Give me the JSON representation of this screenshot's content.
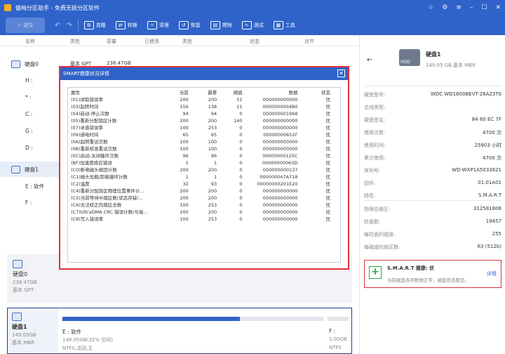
{
  "window": {
    "title": "傲梅分区助手 - 免费无损分区软件"
  },
  "toolbar": {
    "submit": "提交",
    "items": [
      "克隆",
      "转换",
      "清理",
      "恢复",
      "擦除",
      "测试",
      "工具"
    ]
  },
  "columns": [
    "名称",
    "类型",
    "容量",
    "已使用",
    "类型",
    "状态",
    "对齐"
  ],
  "disk0": {
    "label": "硬盘0",
    "type": "基本 GPT",
    "cap": "238.47GB",
    "parts": [
      "H :",
      "* :",
      "C :",
      "G :",
      "D :"
    ]
  },
  "disk1": {
    "label": "硬盘1",
    "parts": [
      "E : 软件",
      "F :"
    ]
  },
  "card1": {
    "name": "硬盘0",
    "size": "238.47GB",
    "type": "基本 GPT"
  },
  "card2": {
    "name": "硬盘1",
    "size": "149.05GB",
    "type": "基本 MBR",
    "part_e": {
      "label": "E : 软件",
      "usage": "148.05GB(32% 空闲)",
      "fs": "NTFS,活动,主",
      "fill": 0.68
    },
    "part_f": {
      "label": "F :",
      "size": "1.00GB",
      "fs": "NTFS"
    }
  },
  "modal": {
    "title": "SMART健康状况详情",
    "headers": [
      "属性",
      "当前",
      "最差",
      "阈值",
      "数据",
      "状态"
    ],
    "rows": [
      [
        "(01)读取错误率",
        "200",
        "200",
        "51",
        "000000000000",
        "优"
      ],
      [
        "(03)起转时间",
        "156",
        "138",
        "21",
        "0000000004B0",
        "优"
      ],
      [
        "(04)启动-停止次数",
        "94",
        "94",
        "0",
        "000000001968",
        "优"
      ],
      [
        "(05)重新分配扇区计数",
        "200",
        "200",
        "140",
        "000000000000",
        "优"
      ],
      [
        "(07)寻道错误率",
        "100",
        "253",
        "0",
        "000000000000",
        "优"
      ],
      [
        "(09)通电时间",
        "65",
        "65",
        "0",
        "00000000652F",
        "优"
      ],
      [
        "(0A)起转重试次数",
        "100",
        "100",
        "0",
        "000000000000",
        "优"
      ],
      [
        "(0B)重新校准重试次数",
        "100",
        "100",
        "0",
        "000000000000",
        "优"
      ],
      [
        "(0C)启动-关闭循环次数",
        "96",
        "96",
        "0",
        "00000000125C",
        "优"
      ],
      [
        "(BF)加速度感应错误",
        "1",
        "1",
        "0",
        "00000000063D",
        "优"
      ],
      [
        "(C0)断电磁头缩回计数",
        "200",
        "200",
        "0",
        "000000000137",
        "优"
      ],
      [
        "(C1)磁头加载/卸载循环计数",
        "1",
        "1",
        "0",
        "000000047A718",
        "优"
      ],
      [
        "(C2)温度",
        "32",
        "93",
        "0",
        "00000000201E20",
        "优"
      ],
      [
        "(C4)重新分配扇区物理位置事件计...",
        "200",
        "200",
        "0",
        "000000000000",
        "优"
      ],
      [
        "(C5)当前等待中扇区数(状态存疑/...",
        "200",
        "200",
        "0",
        "000000000000",
        "优"
      ],
      [
        "(C6)无法校正的扇区总数",
        "100",
        "253",
        "0",
        "000000000000",
        "优"
      ],
      [
        "(C7)UltraDMA CRC 错误计数(与接...",
        "200",
        "200",
        "0",
        "000000000000",
        "优"
      ],
      [
        "(C8)写入错误率",
        "100",
        "253",
        "0",
        "000000000000",
        "优"
      ]
    ]
  },
  "right": {
    "disk_name": "硬盘1",
    "disk_sub": "149.05 GB,基本 MBR",
    "props": [
      [
        "硬盘型号:",
        "WDC WD1600BEVT-26A23T0"
      ],
      [
        "总线类型:",
        ""
      ],
      [
        "硬盘签名:",
        "84 60 EC 7F"
      ],
      [
        "使用次数:",
        "4700 次"
      ],
      [
        "使用时间:",
        "25903 小时"
      ],
      [
        "累计使用:",
        "4700 次"
      ],
      [
        "序列号:",
        "WD-WXP1A5033821"
      ],
      [
        "固件:",
        "01.01A01"
      ],
      [
        "特性:",
        "S.M.A.R.T"
      ]
    ],
    "geo": [
      [
        "物理总扇区:",
        "312581808"
      ],
      [
        "柱面数:",
        "19457"
      ],
      [
        "每柱面的磁道:",
        "255"
      ],
      [
        "每磁道的扇区数:",
        "63 (512b)"
      ]
    ],
    "health_title": "S.M.A.R.T 健康: 优",
    "health_desc": "当前磁盘各项数据正常，磁盘状态稳定。",
    "health_link": "详情"
  }
}
